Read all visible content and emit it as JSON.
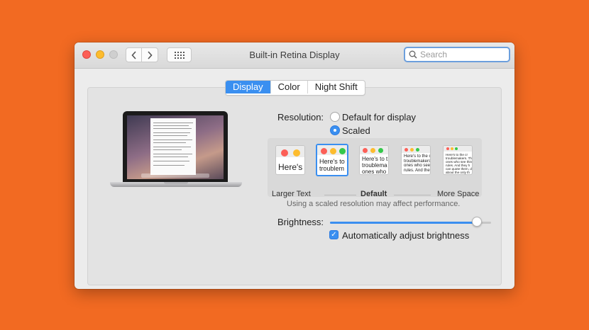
{
  "colors": {
    "background": "#f26a22",
    "accent": "#3a8ff0"
  },
  "titlebar": {
    "title": "Built-in Retina Display",
    "back_icon": "chevron-left-icon",
    "forward_icon": "chevron-right-icon",
    "grid_icon": "grid-icon"
  },
  "search": {
    "placeholder": "Search",
    "value": ""
  },
  "tabs": [
    {
      "label": "Display",
      "active": true
    },
    {
      "label": "Color",
      "active": false
    },
    {
      "label": "Night Shift",
      "active": false
    }
  ],
  "resolution": {
    "label": "Resolution:",
    "options": [
      {
        "label": "Default for display",
        "selected": false
      },
      {
        "label": "Scaled",
        "selected": true
      }
    ]
  },
  "scaling": {
    "left_label": "Larger Text",
    "center_label": "Default",
    "right_label": "More Space",
    "thumbnails": [
      {
        "text": "Here's"
      },
      {
        "text": "Here's to\ntroublem"
      },
      {
        "text": "Here's to t\ntroublema\nones who"
      },
      {
        "text": "Here's to the c\ntroublemakers.\nones who see t\nrules. And they"
      },
      {
        "text": "Here's to the cr\ntroublemakers. Th\nones who see thin\nrules. And they h\ncan quote them, d\nabout the only th"
      }
    ],
    "selected_index": 1
  },
  "note": "Using a scaled resolution may affect performance.",
  "brightness": {
    "label": "Brightness:",
    "level": 0.91
  },
  "auto_brightness": {
    "label": "Automatically adjust brightness",
    "checked": true
  }
}
